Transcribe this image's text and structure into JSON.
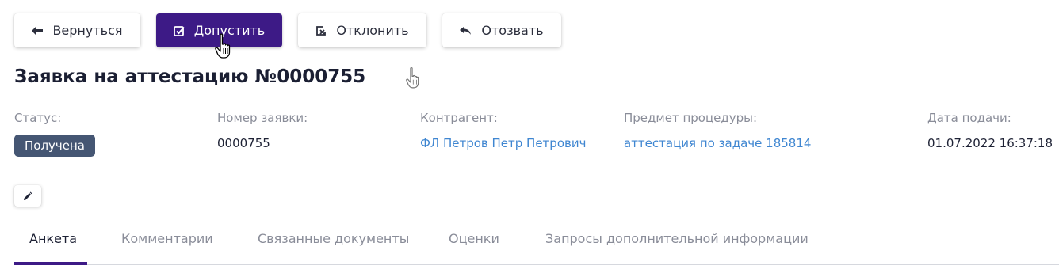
{
  "toolbar": {
    "back_label": "Вернуться",
    "admit_label": "Допустить",
    "reject_label": "Отклонить",
    "recall_label": "Отозвать",
    "icons": {
      "back": "arrow-left-icon",
      "admit": "checkbox-checked-icon",
      "reject": "checkbox-x-icon",
      "recall": "undo-arrow-icon"
    }
  },
  "page_title": "Заявка на аттестацию №0000755",
  "fields": {
    "status": {
      "label": "Статус:",
      "value": "Получена"
    },
    "request_number": {
      "label": "Номер заявки:",
      "value": "0000755"
    },
    "counterparty": {
      "label": "Контрагент:",
      "value": "ФЛ Петров Петр Петрович"
    },
    "subject": {
      "label": "Предмет процедуры:",
      "value": "аттестация по задаче 185814"
    },
    "submitted": {
      "label": "Дата подачи:",
      "value": "01.07.2022 16:37:18"
    }
  },
  "edit": {
    "icon": "pencil-icon"
  },
  "tabs": [
    {
      "label": "Анкета",
      "active": true
    },
    {
      "label": "Комментарии",
      "active": false
    },
    {
      "label": "Связанные документы",
      "active": false
    },
    {
      "label": "Оценки",
      "active": false
    },
    {
      "label": "Запросы дополнительной информации",
      "active": false
    }
  ],
  "colors": {
    "primary": "#3d1a86",
    "badge": "#455673",
    "link": "#3f86d1",
    "muted": "#8a8d99"
  }
}
